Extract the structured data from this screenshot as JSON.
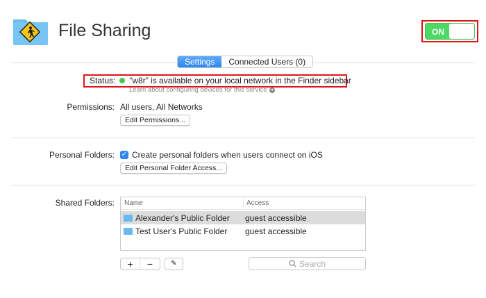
{
  "header": {
    "title": "File Sharing",
    "toggle_label": "ON",
    "toggle_state": true
  },
  "tabs": [
    {
      "label": "Settings",
      "active": true
    },
    {
      "label": "Connected Users (0)",
      "active": false
    }
  ],
  "status": {
    "label": "Status:",
    "text": "“w8r” is available on your local network in the Finder sidebar",
    "color": "#3fc94f",
    "learn_link": "Learn about configuring devices for this service"
  },
  "permissions": {
    "label": "Permissions:",
    "value": "All users, All Networks",
    "button": "Edit Permissions..."
  },
  "personal": {
    "label": "Personal Folders:",
    "checkbox_label": "Create personal folders when users connect on iOS",
    "checked": true,
    "button": "Edit Personal Folder Access..."
  },
  "shared": {
    "label": "Shared Folders:",
    "columns": [
      "Name",
      "Access"
    ],
    "rows": [
      {
        "name": "Alexander's Public Folder",
        "access": "guest accessible",
        "selected": true
      },
      {
        "name": "Test User's Public Folder",
        "access": "guest accessible",
        "selected": false
      }
    ],
    "search_placeholder": "Search",
    "add": "+",
    "remove": "−"
  }
}
